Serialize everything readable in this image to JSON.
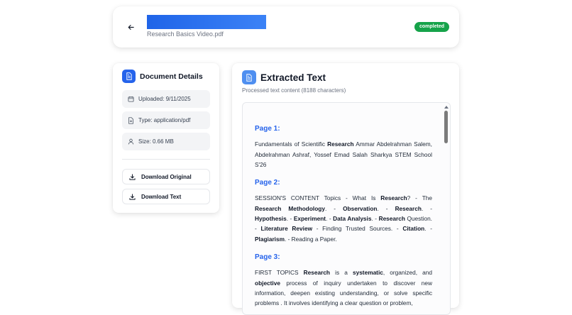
{
  "header": {
    "file_name": "Research Basics Video.pdf",
    "status": "completed",
    "title_bar_color": "#2563eb",
    "status_color": "#16a34a"
  },
  "details": {
    "title": "Document Details",
    "uploaded": "Uploaded: 9/11/2025",
    "type": "Type: application/pdf",
    "size": "Size: 0.66 MB",
    "download_original": "Download Original",
    "download_text": "Download Text"
  },
  "extracted": {
    "title": "Extracted Text",
    "subtitle": "Processed text content (8188 characters)",
    "pages": [
      {
        "heading": "Page 1:",
        "segments": [
          {
            "t": "Fundamentals of Scientific "
          },
          {
            "t": "Research",
            "b": true
          },
          {
            "t": " Ammar Abdelrahman Salem, Abdelrahman Ashraf, Yossef Emad Salah Sharkya STEM School S'26"
          }
        ]
      },
      {
        "heading": "Page 2:",
        "segments": [
          {
            "t": "SESSION'S CONTENT Topics - What Is "
          },
          {
            "t": "Research",
            "b": true
          },
          {
            "t": "? - The "
          },
          {
            "t": "Research Methodology",
            "b": true
          },
          {
            "t": ". - "
          },
          {
            "t": "Observation",
            "b": true
          },
          {
            "t": ". - "
          },
          {
            "t": "Research",
            "b": true
          },
          {
            "t": ". - "
          },
          {
            "t": "Hypothesis",
            "b": true
          },
          {
            "t": ". - "
          },
          {
            "t": "Experiment",
            "b": true
          },
          {
            "t": ". - "
          },
          {
            "t": "Data Analysis",
            "b": true
          },
          {
            "t": ". - "
          },
          {
            "t": "Research",
            "b": true
          },
          {
            "t": " Question. - "
          },
          {
            "t": "Literature Review",
            "b": true
          },
          {
            "t": " - Finding Trusted Sources. - "
          },
          {
            "t": "Citation",
            "b": true
          },
          {
            "t": ". - "
          },
          {
            "t": "Plagiarism",
            "b": true
          },
          {
            "t": ". - Reading a Paper."
          }
        ]
      },
      {
        "heading": "Page 3:",
        "segments": [
          {
            "t": "FIRST TOPICS "
          },
          {
            "t": "Research",
            "b": true
          },
          {
            "t": " is a "
          },
          {
            "t": "systematic",
            "b": true
          },
          {
            "t": ", organized, and "
          },
          {
            "t": "objective",
            "b": true
          },
          {
            "t": " process of inquiry undertaken to discover new information, deepen existing understanding, or solve specific problems . It involves identifying a clear question or problem,"
          }
        ]
      }
    ]
  }
}
